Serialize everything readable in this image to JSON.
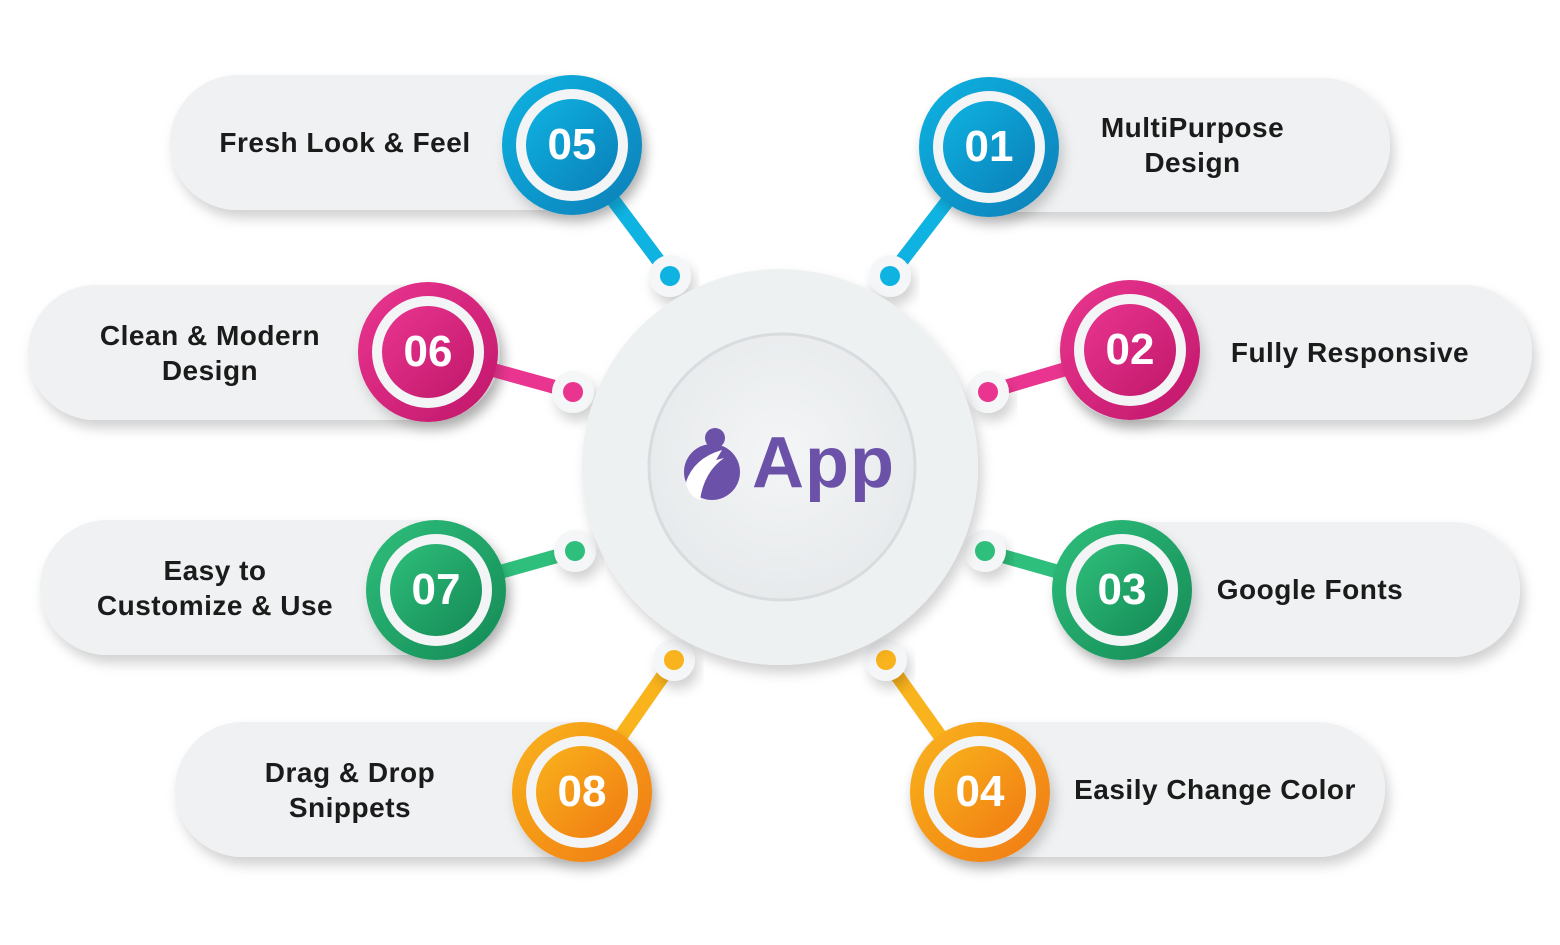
{
  "center": {
    "logo_text": "App",
    "logo_color": "#6b52a8"
  },
  "features": [
    {
      "number": "01",
      "label": "MultiPurpose\nDesign",
      "color": "#0fb3e2",
      "dark": "#0a7fb8"
    },
    {
      "number": "02",
      "label": "Fully Responsive",
      "color": "#ea3590",
      "dark": "#c0186a"
    },
    {
      "number": "03",
      "label": "Google Fonts",
      "color": "#2fbf7c",
      "dark": "#148a55"
    },
    {
      "number": "04",
      "label": "Easily Change Color",
      "color": "#f9b31c",
      "dark": "#f07a12"
    },
    {
      "number": "05",
      "label": "Fresh Look & Feel",
      "color": "#0fb3e2",
      "dark": "#0a7fb8"
    },
    {
      "number": "06",
      "label": "Clean & Modern\nDesign",
      "color": "#ea3590",
      "dark": "#c0186a"
    },
    {
      "number": "07",
      "label": "Easy to\nCustomize & Use",
      "color": "#2fbf7c",
      "dark": "#148a55"
    },
    {
      "number": "08",
      "label": "Drag & Drop\nSnippets",
      "color": "#f9b31c",
      "dark": "#f07a12"
    }
  ]
}
